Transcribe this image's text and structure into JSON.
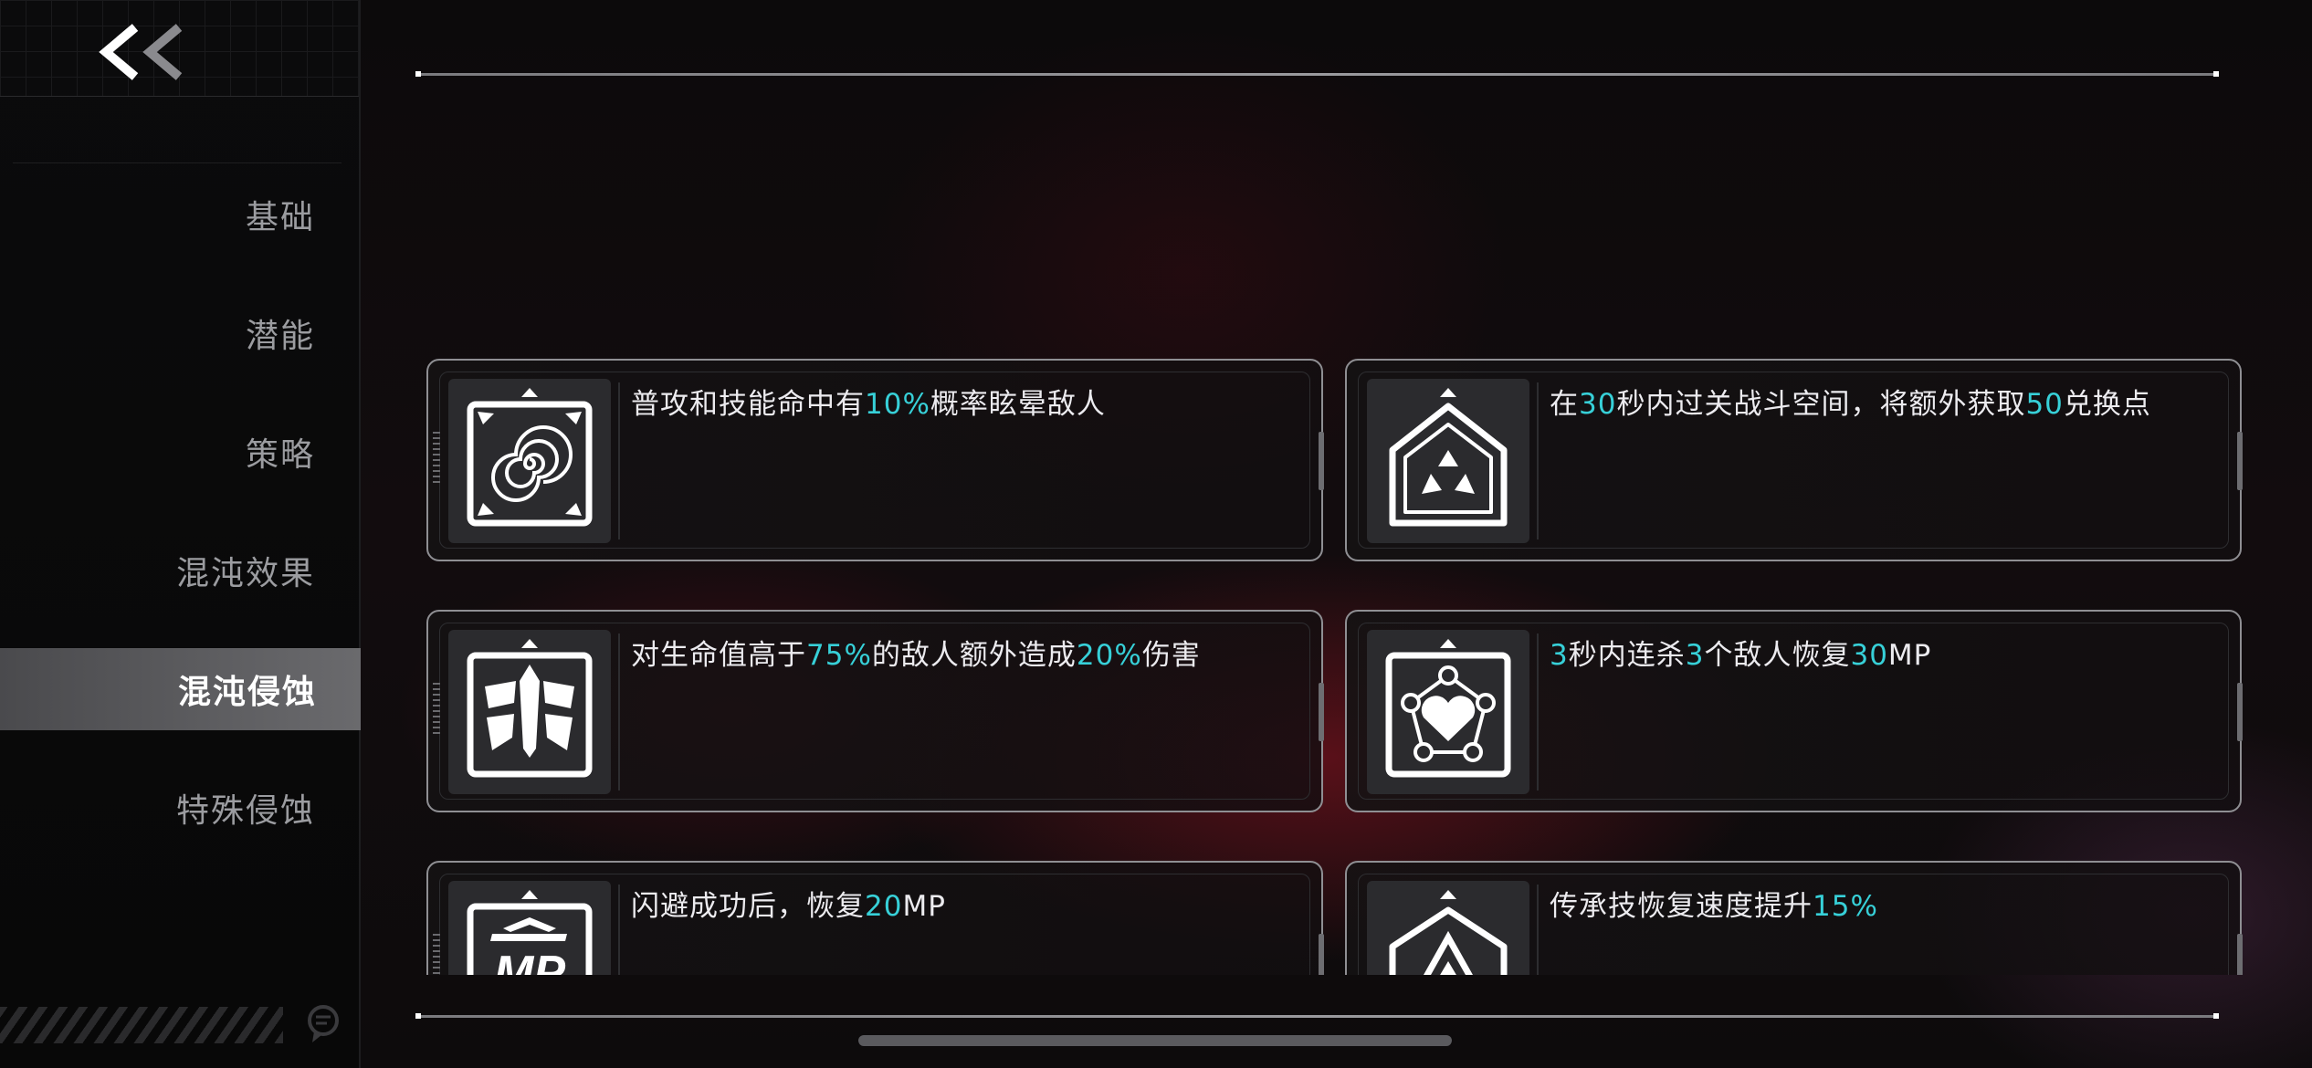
{
  "sidebar": {
    "items": [
      {
        "label": "基础"
      },
      {
        "label": "潜能"
      },
      {
        "label": "策略"
      },
      {
        "label": "混沌效果"
      },
      {
        "label": "混沌侵蚀"
      },
      {
        "label": "特殊侵蚀"
      }
    ],
    "active_index": 4
  },
  "cards": [
    {
      "icon": "spiral-stun-icon",
      "parts": [
        {
          "t": "普攻和技能命中有"
        },
        {
          "t": "10%",
          "hl": true
        },
        {
          "t": "概率眩晕敌人"
        }
      ]
    },
    {
      "icon": "house-trefoil-icon",
      "parts": [
        {
          "t": "在"
        },
        {
          "t": "30",
          "hl": true
        },
        {
          "t": "秒内过关战斗空间，将额外获取"
        },
        {
          "t": "50",
          "hl": true
        },
        {
          "t": "兑换点"
        }
      ]
    },
    {
      "icon": "blade-damage-icon",
      "parts": [
        {
          "t": "对生命值高于"
        },
        {
          "t": "75%",
          "hl": true
        },
        {
          "t": "的敌人额外造成"
        },
        {
          "t": "20%",
          "hl": true
        },
        {
          "t": "伤害"
        }
      ]
    },
    {
      "icon": "heart-combo-icon",
      "parts": [
        {
          "t": "3",
          "hl": true
        },
        {
          "t": "秒内连杀"
        },
        {
          "t": "3",
          "hl": true
        },
        {
          "t": "个敌人恢复"
        },
        {
          "t": "30",
          "hl": true
        },
        {
          "t": "MP"
        }
      ]
    },
    {
      "icon": "mp-badge-icon",
      "parts": [
        {
          "t": "闪避成功后，恢复"
        },
        {
          "t": "20",
          "hl": true
        },
        {
          "t": "MP"
        }
      ]
    },
    {
      "icon": "triangle-skill-icon",
      "parts": [
        {
          "t": "传承技恢复速度提升"
        },
        {
          "t": "15%",
          "hl": true
        }
      ]
    }
  ],
  "icons": {
    "back": "double-chevron-left-icon",
    "feedback": "feedback-icon"
  },
  "colors": {
    "highlight": "#37d0d8",
    "active_tab": "#5a5a5d"
  }
}
